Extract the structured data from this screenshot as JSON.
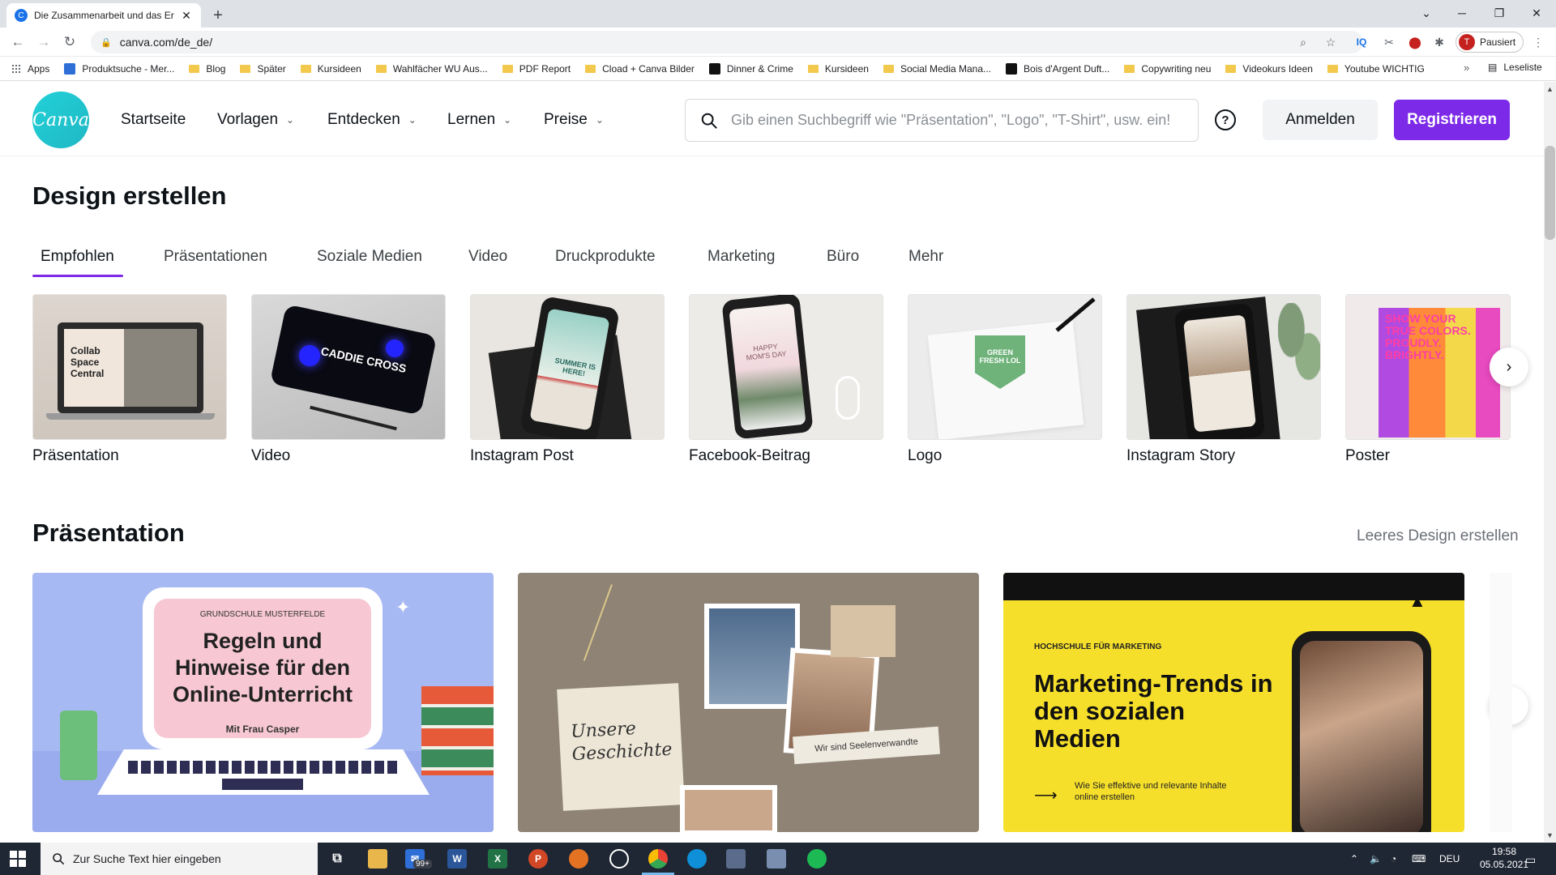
{
  "browser": {
    "tab_title": "Die Zusammenarbeit und das Er",
    "tab_favicon": "C",
    "url": "canva.com/de_de/",
    "profile_initial": "T",
    "profile_status": "Pausiert",
    "bookmarks": [
      {
        "label": "Apps",
        "icon": "apps-grid-icon"
      },
      {
        "label": "Produktsuche - Mer...",
        "icon": "site-icon"
      },
      {
        "label": "Blog",
        "icon": "folder-icon"
      },
      {
        "label": "Später",
        "icon": "folder-icon"
      },
      {
        "label": "Kursideen",
        "icon": "folder-icon"
      },
      {
        "label": "Wahlfächer WU Aus...",
        "icon": "folder-icon"
      },
      {
        "label": "PDF Report",
        "icon": "folder-icon"
      },
      {
        "label": "Cload + Canva Bilder",
        "icon": "folder-icon"
      },
      {
        "label": "Dinner & Crime",
        "icon": "site-icon"
      },
      {
        "label": "Kursideen",
        "icon": "folder-icon"
      },
      {
        "label": "Social Media Mana...",
        "icon": "folder-icon"
      },
      {
        "label": "Bois d'Argent Duft...",
        "icon": "site-icon"
      },
      {
        "label": "Copywriting neu",
        "icon": "folder-icon"
      },
      {
        "label": "Videokurs Ideen",
        "icon": "folder-icon"
      },
      {
        "label": "Youtube WICHTIG",
        "icon": "folder-icon"
      }
    ],
    "reading_list": "Leseliste",
    "overflow": "»"
  },
  "header": {
    "logo_text": "Canva",
    "nav": [
      {
        "label": "Startseite",
        "dropdown": false
      },
      {
        "label": "Vorlagen",
        "dropdown": true
      },
      {
        "label": "Entdecken",
        "dropdown": true
      },
      {
        "label": "Lernen",
        "dropdown": true
      },
      {
        "label": "Preise",
        "dropdown": true
      }
    ],
    "search_placeholder": "Gib einen Suchbegriff wie \"Präsentation\", \"Logo\", \"T-Shirt\", usw. ein!",
    "help": "?",
    "login_label": "Anmelden",
    "register_label": "Registrieren"
  },
  "create": {
    "title": "Design erstellen",
    "tabs": [
      "Empfohlen",
      "Präsentationen",
      "Soziale Medien",
      "Video",
      "Druckprodukte",
      "Marketing",
      "Büro",
      "Mehr"
    ],
    "active_tab": "Empfohlen",
    "cards": [
      {
        "label": "Präsentation",
        "art_text": "Collab Space Central"
      },
      {
        "label": "Video",
        "art_text": "CADDIE CROSS"
      },
      {
        "label": "Instagram Post",
        "art_text": "SUMMER IS HERE!"
      },
      {
        "label": "Facebook-Beitrag",
        "art_text": "HAPPY MOM'S DAY"
      },
      {
        "label": "Logo",
        "art_text": "GREEN FRESH LOL"
      },
      {
        "label": "Instagram Story",
        "art_text": ""
      },
      {
        "label": "Poster",
        "art_text": "SHOW YOUR TRUE COLORS. PROUDLY. BRIGHTLY."
      }
    ]
  },
  "presentation": {
    "title": "Präsentation",
    "blank_link": "Leeres Design erstellen",
    "templates": [
      {
        "kicker": "GRUNDSCHULE MUSTERFELDE",
        "title": "Regeln und Hinweise für den Online-Unterricht",
        "sub": "Mit Frau Casper"
      },
      {
        "title": "Unsere Geschichte",
        "sub": "Wir sind Seelenverwandte"
      },
      {
        "kicker": "HOCHSCHULE FÜR MARKETING",
        "title": "Marketing-Trends in den sozialen Medien",
        "sub": "Wie Sie effektive und relevante Inhalte online erstellen"
      }
    ]
  },
  "taskbar": {
    "search_placeholder": "Zur Suche Text hier eingeben",
    "badge": "99+",
    "lang": "DEU",
    "time": "19:58",
    "date": "05.05.2021"
  },
  "colors": {
    "accent": "#7d2ae8",
    "canva_teal": "#20c4cb"
  }
}
